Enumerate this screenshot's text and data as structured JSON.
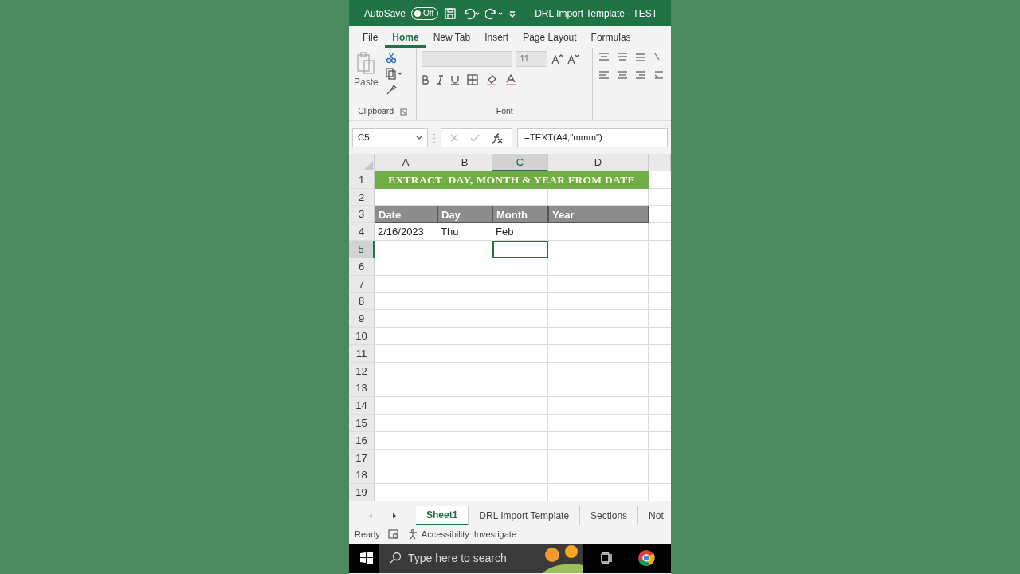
{
  "window": {
    "autosave_label": "AutoSave",
    "autosave_toggle": {
      "label": "Off",
      "on": false
    },
    "title": "DRL Import Template - TEST"
  },
  "ribbon_tabs": [
    {
      "label": "File",
      "selected": false
    },
    {
      "label": "Home",
      "selected": true
    },
    {
      "label": "New Tab",
      "selected": false
    },
    {
      "label": "Insert",
      "selected": false
    },
    {
      "label": "Page Layout",
      "selected": false
    },
    {
      "label": "Formulas",
      "selected": false
    }
  ],
  "ribbon": {
    "paste_label": "Paste",
    "clipboard_label": "Clipboard",
    "font_size": "11",
    "font_label": "Font"
  },
  "formula_bar": {
    "name_box": "C5",
    "formula": "=TEXT(A4,\"mmm\")"
  },
  "columns": [
    {
      "label": "A",
      "selected": false
    },
    {
      "label": "B",
      "selected": false
    },
    {
      "label": "C",
      "selected": true
    },
    {
      "label": "D",
      "selected": false
    }
  ],
  "rows": [
    {
      "number": "1",
      "selected": false,
      "cells": [
        {
          "kind": "title",
          "text": "EXTRACT  DAY, MONTH & YEAR FROM DATE"
        }
      ]
    },
    {
      "number": "2",
      "selected": false
    },
    {
      "number": "3",
      "selected": false,
      "cells": [
        {
          "kind": "header",
          "text": "Date"
        },
        {
          "kind": "header",
          "text": "Day"
        },
        {
          "kind": "header",
          "text": "Month"
        },
        {
          "kind": "header",
          "text": "Year"
        }
      ]
    },
    {
      "number": "4",
      "selected": false,
      "cells": [
        {
          "kind": "value",
          "text": "2/16/2023"
        },
        {
          "kind": "value",
          "text": "Thu"
        },
        {
          "kind": "value",
          "text": "Feb"
        }
      ]
    },
    {
      "number": "5",
      "selected": true
    },
    {
      "number": "6",
      "selected": false
    },
    {
      "number": "7",
      "selected": false
    },
    {
      "number": "8",
      "selected": false
    },
    {
      "number": "9",
      "selected": false
    },
    {
      "number": "10",
      "selected": false
    },
    {
      "number": "11",
      "selected": false
    },
    {
      "number": "12",
      "selected": false
    },
    {
      "number": "13",
      "selected": false
    },
    {
      "number": "14",
      "selected": false
    },
    {
      "number": "15",
      "selected": false
    },
    {
      "number": "16",
      "selected": false
    },
    {
      "number": "17",
      "selected": false
    },
    {
      "number": "18",
      "selected": false
    },
    {
      "number": "19",
      "selected": false
    }
  ],
  "sheet_tabs": [
    {
      "label": "Sheet1",
      "selected": true
    },
    {
      "label": "DRL Import Template",
      "selected": false
    },
    {
      "label": "Sections",
      "selected": false
    },
    {
      "label": "Not",
      "selected": false
    }
  ],
  "status_bar": {
    "mode": "Ready",
    "accessibility": "Accessibility: Investigate"
  },
  "taskbar": {
    "search_placeholder": "Type here to search"
  }
}
